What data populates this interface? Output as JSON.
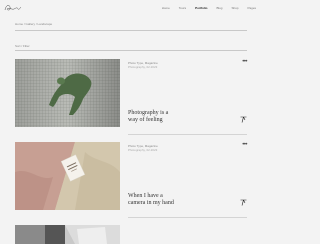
{
  "nav": {
    "items": [
      {
        "label": "Home",
        "active": false
      },
      {
        "label": "Tours",
        "active": false
      },
      {
        "label": "Portfolio",
        "active": true
      },
      {
        "label": "Blog",
        "active": false
      },
      {
        "label": "Shop",
        "active": false
      },
      {
        "label": "Pages",
        "active": false
      }
    ]
  },
  "breadcrumb": "Home / Gallery / Landscape",
  "filter_label": "Sort / Filter",
  "posts": [
    {
      "meta": "Photo Type, Magazine",
      "date": "Photography, 02.2023",
      "title_line1": "Photography is a",
      "title_line2": "way of feeling",
      "more": "•••"
    },
    {
      "meta": "Photo Type, Magazine",
      "date": "Photography, 02.2023",
      "title_line1": "When I have a",
      "title_line2": "camera in my hand",
      "more": "•••"
    }
  ],
  "colors": {
    "background": "#f3f3f3",
    "text": "#222222",
    "muted": "#888888",
    "divider": "#c8c8c8"
  }
}
